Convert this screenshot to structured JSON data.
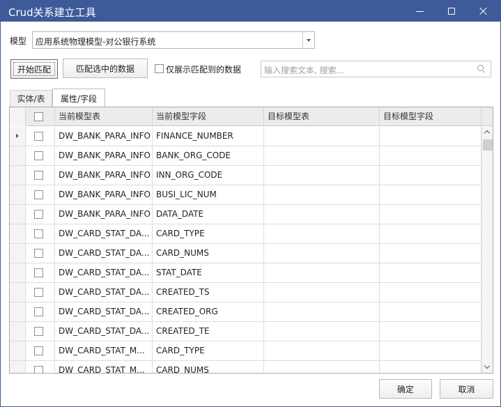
{
  "window": {
    "title": "Crud关系建立工具"
  },
  "model": {
    "label": "模型",
    "selected": "应用系统物理模型-对公银行系统"
  },
  "toolbar": {
    "match_label": "开始匹配",
    "match_selected_label": "匹配选中的数据",
    "only_show_matched_label": "仅展示匹配到的数据",
    "search_placeholder": "输入搜索文本, 搜索..."
  },
  "tabs": [
    {
      "label": "实体/表",
      "active": false
    },
    {
      "label": "属性/字段",
      "active": true
    }
  ],
  "grid": {
    "columns": [
      "当前模型表",
      "当前模型字段",
      "目标模型表",
      "目标模型字段"
    ],
    "rows": [
      {
        "table": "DW_BANK_PARA_INFO",
        "field": "FINANCE_NUMBER",
        "target_table": "",
        "target_field": ""
      },
      {
        "table": "DW_BANK_PARA_INFO",
        "field": "BANK_ORG_CODE",
        "target_table": "",
        "target_field": ""
      },
      {
        "table": "DW_BANK_PARA_INFO",
        "field": "INN_ORG_CODE",
        "target_table": "",
        "target_field": ""
      },
      {
        "table": "DW_BANK_PARA_INFO",
        "field": "BUSI_LIC_NUM",
        "target_table": "",
        "target_field": ""
      },
      {
        "table": "DW_BANK_PARA_INFO",
        "field": "DATA_DATE",
        "target_table": "",
        "target_field": ""
      },
      {
        "table": "DW_CARD_STAT_DA...",
        "field": "CARD_TYPE",
        "target_table": "",
        "target_field": ""
      },
      {
        "table": "DW_CARD_STAT_DA...",
        "field": "CARD_NUMS",
        "target_table": "",
        "target_field": ""
      },
      {
        "table": "DW_CARD_STAT_DA...",
        "field": "STAT_DATE",
        "target_table": "",
        "target_field": ""
      },
      {
        "table": "DW_CARD_STAT_DA...",
        "field": "CREATED_TS",
        "target_table": "",
        "target_field": ""
      },
      {
        "table": "DW_CARD_STAT_DA...",
        "field": "CREATED_ORG",
        "target_table": "",
        "target_field": ""
      },
      {
        "table": "DW_CARD_STAT_DA...",
        "field": "CREATED_TE",
        "target_table": "",
        "target_field": ""
      },
      {
        "table": "DW_CARD_STAT_M...",
        "field": "CARD_TYPE",
        "target_table": "",
        "target_field": ""
      },
      {
        "table": "DW_CARD_STAT_M...",
        "field": "CARD_NUMS",
        "target_table": "",
        "target_field": ""
      }
    ]
  },
  "footer": {
    "ok_label": "确定",
    "cancel_label": "取消"
  },
  "colors": {
    "titlebar": "#3d5a99",
    "header_bg": "#ececec"
  }
}
